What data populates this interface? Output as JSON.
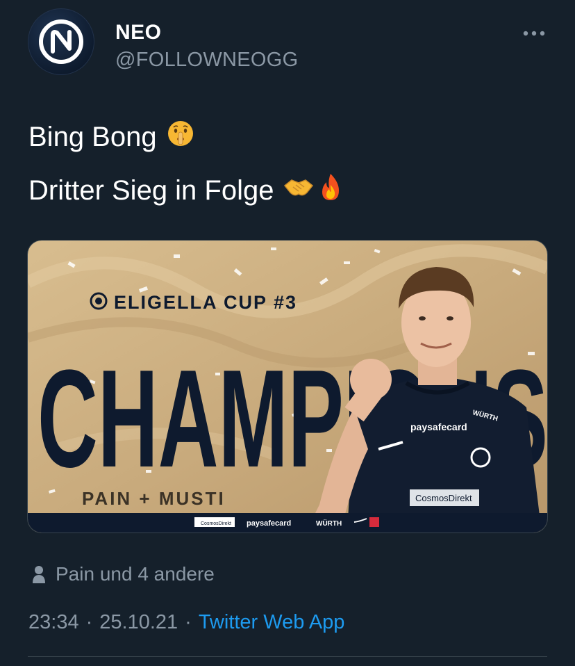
{
  "author": {
    "display_name": "NEO",
    "handle": "@FOLLOWNEOGG"
  },
  "tweet": {
    "line1": "Bing Bong",
    "line1_emoji": "shushing-face-emoji",
    "line2": "Dritter Sieg in Folge",
    "line2_emojis": [
      "handshake-emoji",
      "fire-emoji"
    ]
  },
  "media": {
    "event": "ELIGELLA CUP #3",
    "headline": "CHAMPIONS",
    "players": "PAIN + MUSTI",
    "jersey_sponsor": "paysafecard",
    "jersey_sleeve": "WÜRTH",
    "jersey_bottom": "CosmosDirekt",
    "sponsors": [
      "CosmosDirekt",
      "paysafecard",
      "WÜRTH",
      "Nike",
      "Ai"
    ],
    "colors": {
      "gold": "#c9ab7d",
      "navy": "#0e1a2e"
    }
  },
  "liked_by": "Pain und 4 andere",
  "meta": {
    "time": "23:34",
    "separator": "·",
    "date": "25.10.21",
    "source": "Twitter Web App"
  },
  "colors": {
    "background": "#15202b",
    "secondary_text": "#8b98a5",
    "link": "#1d9bf0"
  }
}
